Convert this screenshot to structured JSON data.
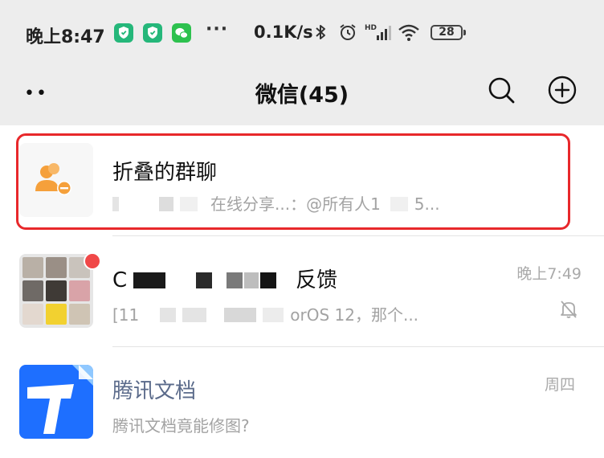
{
  "status_bar": {
    "time": "晚上8:47",
    "more": "···",
    "net_speed": "0.1K/s",
    "battery": "28",
    "icons": [
      "shield-app-icon",
      "shield-app-icon",
      "wechat-app-icon",
      "bluetooth-icon",
      "alarm-icon",
      "hd-signal-icon",
      "wifi-icon",
      "battery-icon"
    ]
  },
  "header": {
    "dots": "••",
    "title": "微信(45)",
    "icons": [
      "search-icon",
      "add-circle-icon"
    ]
  },
  "chats": [
    {
      "name": "折叠的群聊",
      "preview": "在线分享...：@所有人1",
      "preview_suffix": "5...",
      "time": "",
      "avatar_icon": "folded-group-icon",
      "highlight_color": "#e8282b"
    },
    {
      "name_prefix": "C",
      "name_suffix": "反馈",
      "preview_prefix": "[11",
      "preview_suffix": "orOS 12，那个...",
      "time": "晚上7:49",
      "icons": [
        "mute-bell-icon"
      ],
      "unread_dot_color": "#f04848"
    },
    {
      "name": "腾讯文档",
      "preview": "腾讯文档竟能修图?",
      "time": "周四",
      "avatar_icon": "tencent-docs-icon",
      "brand_color": "#1e6fff"
    }
  ]
}
